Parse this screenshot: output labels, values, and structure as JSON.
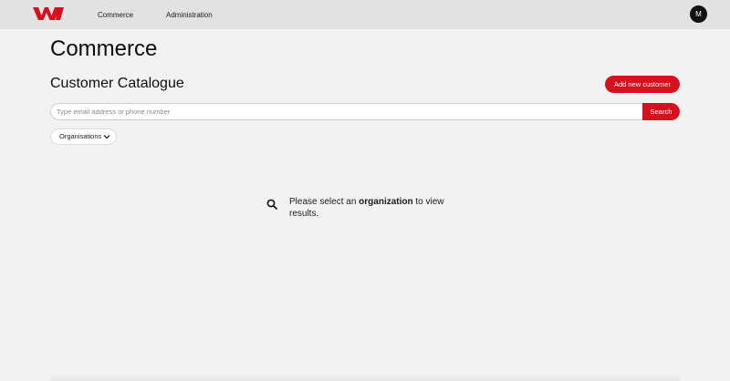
{
  "header": {
    "nav": [
      {
        "label": "Commerce"
      },
      {
        "label": "Administration"
      }
    ],
    "avatar_initial": "M"
  },
  "page": {
    "title": "Commerce",
    "section_title": "Customer Catalogue",
    "add_button_label": "Add new customer"
  },
  "search": {
    "placeholder": "Type email address or phone number",
    "value": "",
    "button_label": "Search"
  },
  "filters": {
    "organisations_label": "Organisations"
  },
  "empty_state": {
    "text_before": "Please select an ",
    "text_bold": "organization",
    "text_after": " to view results."
  },
  "colors": {
    "brand_red": "#d5101f",
    "topbar_bg": "#e2e2e2",
    "page_bg": "#f2f2f2"
  }
}
